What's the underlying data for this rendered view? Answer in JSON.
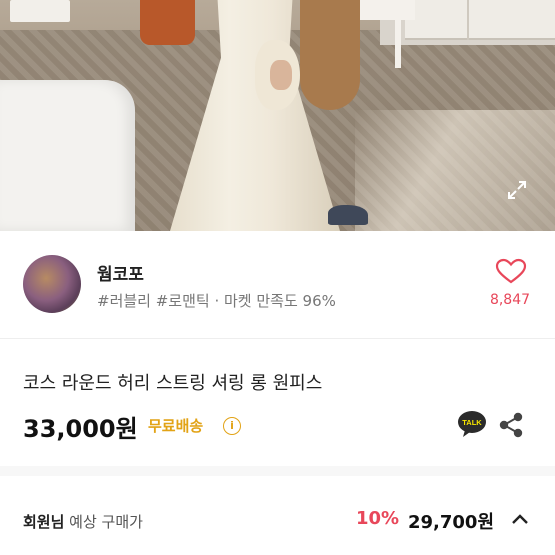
{
  "seller": {
    "name": "웜코포",
    "tags": "#러블리 #로맨틱 · 마켓 만족도 96%",
    "like_count": "8,847"
  },
  "product": {
    "title": "코스 라운드 허리 스트링 셔링 롱 원피스",
    "price": "33,000원",
    "shipping_label": "무료배송",
    "info_glyph": "i",
    "talk_label": "TALK"
  },
  "member_price": {
    "label_bold": "회원님",
    "label_rest": " 예상 구매가",
    "discount": "10%",
    "price": "29,700원"
  },
  "colors": {
    "accent_red": "#e8475a",
    "shipping_yellow": "#e2a316"
  },
  "icons": {
    "expand": "expand-icon",
    "like": "heart-icon",
    "talk": "kakaotalk-icon",
    "share": "share-icon",
    "collapse": "chevron-up-icon"
  }
}
